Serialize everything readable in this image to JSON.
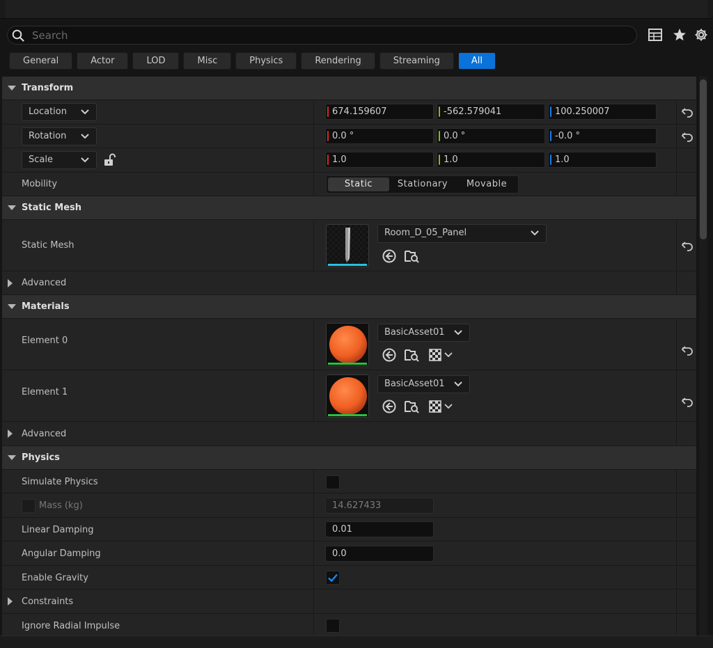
{
  "search": {
    "placeholder": "Search"
  },
  "filters": [
    "General",
    "Actor",
    "LOD",
    "Misc",
    "Physics",
    "Rendering",
    "Streaming",
    "All"
  ],
  "active_filter": "All",
  "colors": {
    "accent": "#0a72d8",
    "x_axis": "#d42a1e",
    "y_axis": "#7fbc1d",
    "z_axis": "#1e7ae8",
    "mesh_line": "#27c1e0",
    "material_line": "#2bbf3f",
    "material_sphere": "#f06a2a"
  },
  "transform": {
    "header": "Transform",
    "location": {
      "label": "Location",
      "x": "674.159607",
      "y": "-562.579041",
      "z": "100.250007"
    },
    "rotation": {
      "label": "Rotation",
      "x": "0.0 °",
      "y": "0.0 °",
      "z": "-0.0 °"
    },
    "scale": {
      "label": "Scale",
      "x": "1.0",
      "y": "1.0",
      "z": "1.0"
    },
    "mobility": {
      "label": "Mobility",
      "options": [
        "Static",
        "Stationary",
        "Movable"
      ],
      "selected": "Static"
    }
  },
  "static_mesh": {
    "header": "Static Mesh",
    "label": "Static Mesh",
    "value": "Room_D_05_Panel",
    "advanced": "Advanced"
  },
  "materials": {
    "header": "Materials",
    "elements": [
      {
        "label": "Element 0",
        "value": "BasicAsset01"
      },
      {
        "label": "Element 1",
        "value": "BasicAsset01"
      }
    ],
    "advanced": "Advanced"
  },
  "physics": {
    "header": "Physics",
    "simulate_physics": {
      "label": "Simulate Physics",
      "checked": false
    },
    "mass": {
      "label": "Mass (kg)",
      "value": "14.627433",
      "enabled": false
    },
    "linear_damping": {
      "label": "Linear Damping",
      "value": "0.01"
    },
    "angular_damping": {
      "label": "Angular Damping",
      "value": "0.0"
    },
    "enable_gravity": {
      "label": "Enable Gravity",
      "checked": true
    },
    "constraints": "Constraints",
    "ignore_radial_impulse": {
      "label": "Ignore Radial Impulse",
      "checked": false
    }
  }
}
